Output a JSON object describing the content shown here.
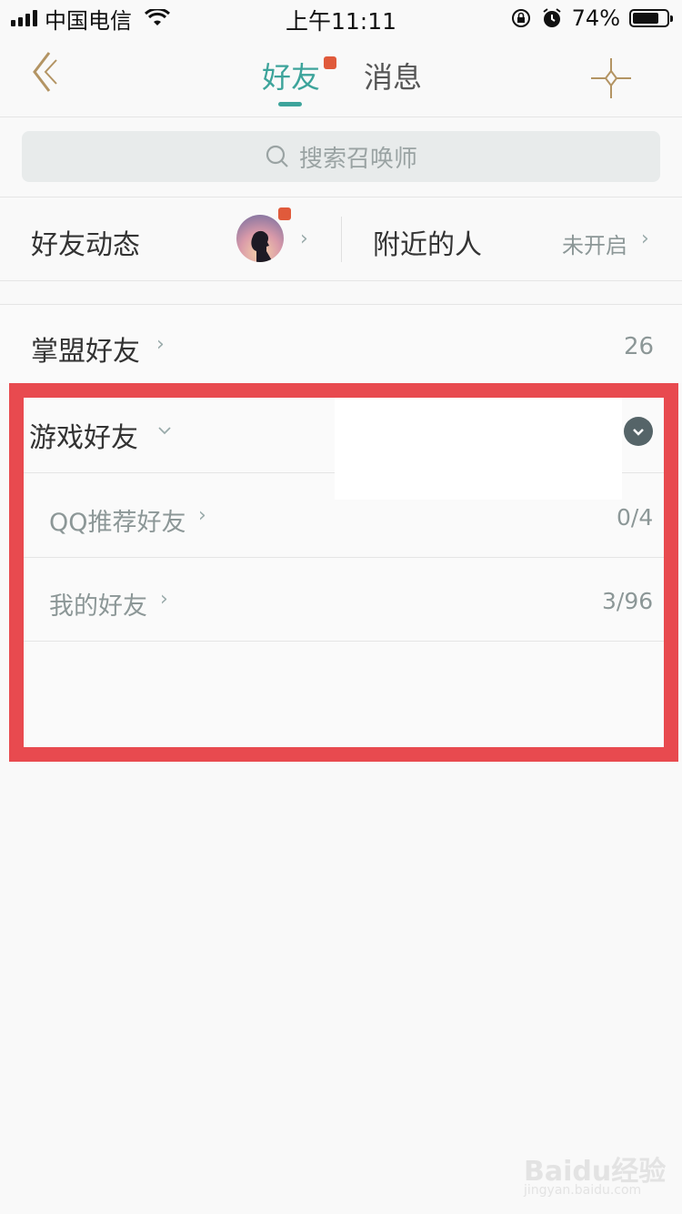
{
  "status_bar": {
    "carrier": "中国电信",
    "time": "上午11:11",
    "battery": "74%",
    "battery_level": 0.74
  },
  "nav": {
    "tabs": [
      {
        "label": "好友",
        "active": true,
        "has_badge": true
      },
      {
        "label": "消息",
        "active": false
      }
    ]
  },
  "search": {
    "placeholder": "搜索召唤师"
  },
  "feeds": {
    "friend_feed_label": "好友动态",
    "nearby_label": "附近的人",
    "nearby_status": "未开启"
  },
  "groups": {
    "league_friends": {
      "label": "掌盟好友",
      "count": "26"
    },
    "game_friends": {
      "label": "游戏好友",
      "items": [
        {
          "label": "QQ推荐好友",
          "value": "0/4"
        },
        {
          "label": "我的好友",
          "value": "3/96"
        }
      ]
    }
  },
  "watermark": {
    "text": "Baidu经验",
    "url_text": "jingyan.baidu.com"
  },
  "colors": {
    "accent": "#3da49b",
    "badge": "#e05a3b",
    "highlight": "#e84a4f",
    "gold_icon": "#b39463"
  }
}
